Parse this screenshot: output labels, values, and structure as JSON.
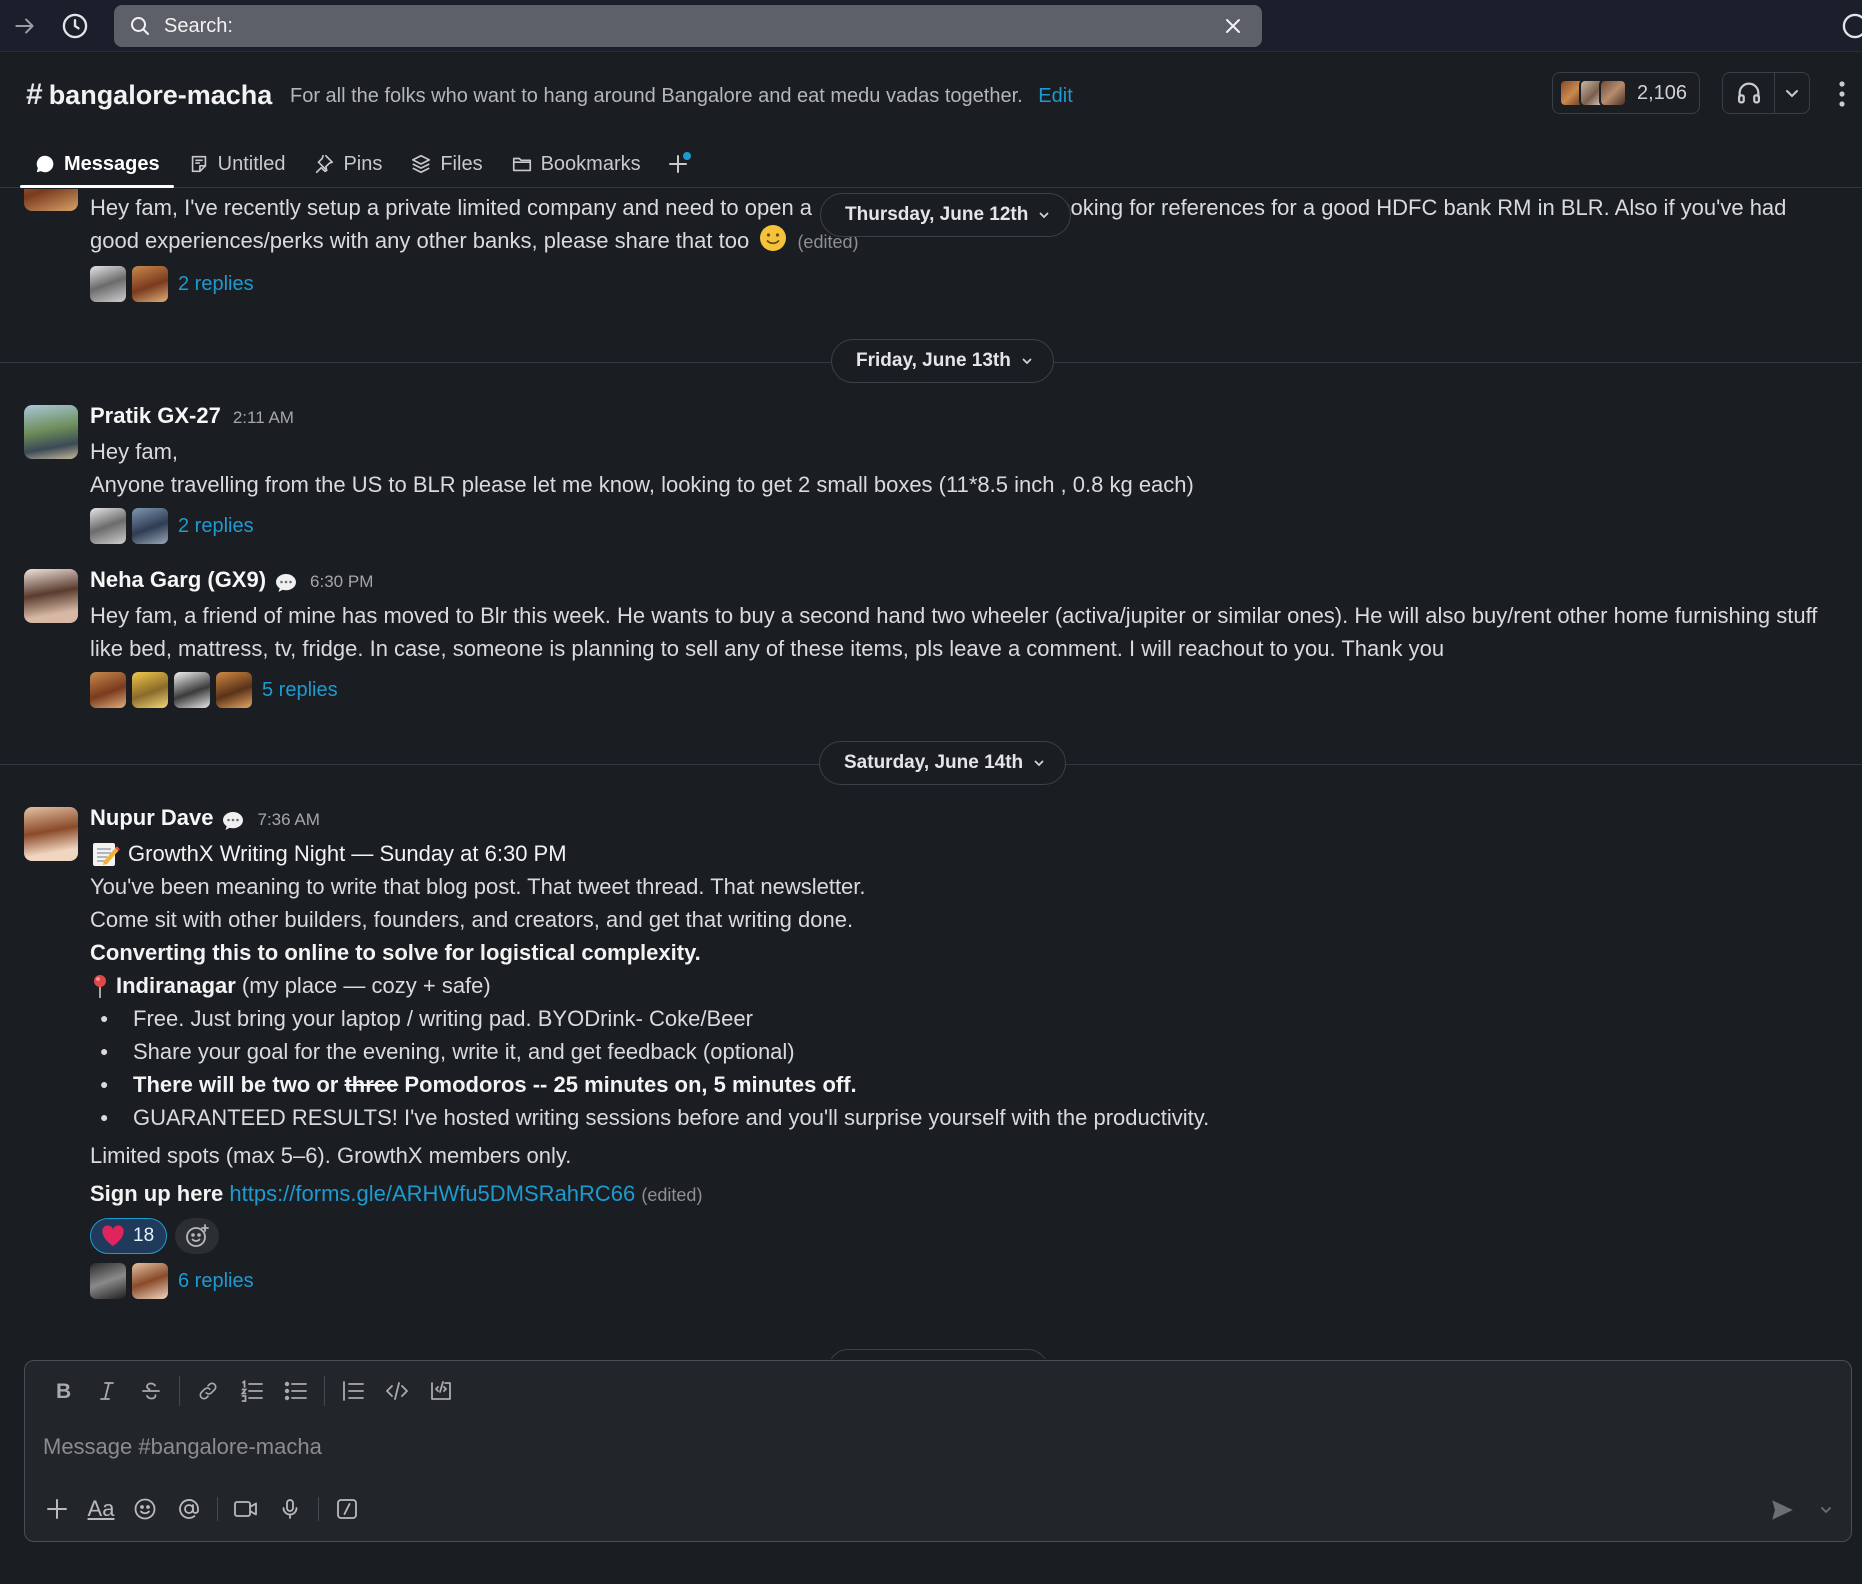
{
  "search": {
    "label": "Search:"
  },
  "channel": {
    "name": "bangalore-macha",
    "hash": "#",
    "topic": "For all the folks who want to hang around Bangalore and eat medu vadas together.",
    "edit_label": "Edit",
    "member_count": "2,106"
  },
  "tabs": [
    {
      "label": "Messages",
      "icon": "message-bubble-icon",
      "active": true
    },
    {
      "label": "Untitled",
      "icon": "canvas-icon"
    },
    {
      "label": "Pins",
      "icon": "pin-icon"
    },
    {
      "label": "Files",
      "icon": "files-icon"
    },
    {
      "label": "Bookmarks",
      "icon": "folder-icon"
    }
  ],
  "dates": {
    "d1": "Thursday, June 12th",
    "d2": "Friday, June 13th",
    "d3": "Saturday, June 14th"
  },
  "messages": {
    "m0": {
      "text1": "Hey fam, I've recently setup a private limited company and need to open a",
      "text2": "Looking for references for a good HDFC bank RM in BLR. Also if you've had",
      "text3": "good experiences/perks with any other banks, please share that too",
      "edited": "(edited)",
      "replies": "2 replies"
    },
    "m1": {
      "name": "Pratik GX-27",
      "time": "2:11 AM",
      "line1": "Hey fam,",
      "line2": "Anyone travelling from the US to BLR please let me know, looking to get 2 small boxes (11*8.5 inch , 0.8 kg each)",
      "replies": "2 replies"
    },
    "m2": {
      "name": "Neha Garg (GX9)",
      "time": "6:30 PM",
      "text": "Hey fam, a friend of mine has moved to Blr this week. He wants to buy a second hand two wheeler (activa/jupiter or similar ones). He will also buy/rent other home furnishing stuff like bed, mattress, tv, fridge. In case, someone is planning to sell any of these items, pls leave a comment. I will reachout to you. Thank you",
      "replies": "5 replies"
    },
    "m3": {
      "name": "Nupur Dave",
      "time": "7:36 AM",
      "title": "GrowthX Writing Night — Sunday at 6:30 PM",
      "line1": "You've been meaning to write that blog post. That tweet thread. That newsletter.",
      "line2": "Come sit with other builders, founders, and creators, and get that writing done.",
      "line3": "Converting this to online to solve for logistical complexity.",
      "place_bold": "Indiranagar",
      "place_rest": " (my place — cozy + safe)",
      "bullets": {
        "b1": "Free. Just bring your laptop / writing pad.  BYODrink- Coke/Beer",
        "b2": "Share your goal for the evening, write it, and get feedback (optional)",
        "b3a": "There will be two or ",
        "b3s": "three",
        "b3b": " Pomodoros -- 25 minutes on, 5 minutes off.",
        "b4": "GUARANTEED RESULTS! I've hosted writing sessions before and you'll surprise yourself with the productivity."
      },
      "limited": "Limited spots (max 5–6). GrowthX members only.",
      "signup": "Sign up here",
      "url": "https://forms.gle/ARHWfu5DMSRahRC66",
      "edited": "(edited)",
      "reaction_count": "18",
      "replies": "6 replies"
    }
  },
  "composer": {
    "placeholder": "Message #bangalore-macha",
    "aa_label": "Aa"
  },
  "colors": {
    "accent_link": "#1d9bd1",
    "background": "#1a1d21",
    "topbar": "#1b1f2b"
  }
}
